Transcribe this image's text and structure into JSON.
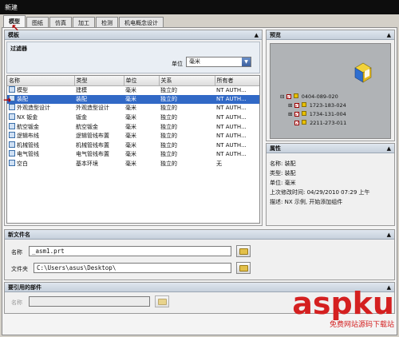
{
  "window": {
    "title": "新建"
  },
  "tabs": [
    "模型",
    "图纸",
    "仿真",
    "加工",
    "检测",
    "机电概念设计"
  ],
  "template_panel": {
    "title": "模板",
    "filter_title": "过滤器",
    "unit_label": "单位",
    "unit_value": "毫米",
    "columns": [
      "名称",
      "类型",
      "单位",
      "关系",
      "所有者"
    ],
    "rows": [
      {
        "name": "模型",
        "type": "建模",
        "unit": "毫米",
        "relation": "独立的",
        "owner": "NT AUTH...",
        "icon": "model-icon",
        "selected": false
      },
      {
        "name": "装配",
        "type": "装配",
        "unit": "毫米",
        "relation": "独立的",
        "owner": "NT AUTH...",
        "icon": "assembly-icon",
        "selected": true
      },
      {
        "name": "外观造型设计",
        "type": "外观造型设计",
        "unit": "毫米",
        "relation": "独立的",
        "owner": "NT AUTH...",
        "icon": "shape-studio-icon",
        "selected": false
      },
      {
        "name": "NX 钣金",
        "type": "钣金",
        "unit": "毫米",
        "relation": "独立的",
        "owner": "NT AUTH...",
        "icon": "sheet-metal-icon",
        "selected": false
      },
      {
        "name": "航空钣金",
        "type": "航空钣金",
        "unit": "毫米",
        "relation": "独立的",
        "owner": "NT AUTH...",
        "icon": "aero-sheet-metal-icon",
        "selected": false
      },
      {
        "name": "逻辑布线",
        "type": "逻辑管线布置",
        "unit": "毫米",
        "relation": "独立的",
        "owner": "NT AUTH...",
        "icon": "logical-routing-icon",
        "selected": false
      },
      {
        "name": "机械管线",
        "type": "机械管线布置",
        "unit": "毫米",
        "relation": "独立的",
        "owner": "NT AUTH...",
        "icon": "mechanical-routing-icon",
        "selected": false
      },
      {
        "name": "电气管线",
        "type": "电气管线布置",
        "unit": "毫米",
        "relation": "独立的",
        "owner": "NT AUTH...",
        "icon": "electrical-routing-icon",
        "selected": false
      },
      {
        "name": "空白",
        "type": "基本环境",
        "unit": "毫米",
        "relation": "独立的",
        "owner": "无",
        "icon": "blank-icon",
        "selected": false
      }
    ]
  },
  "preview": {
    "title": "预览",
    "tree": [
      "0404-089-020",
      "1723-183-024",
      "1734-131-004",
      "2211-273-011"
    ]
  },
  "properties": {
    "title": "属性",
    "rows": [
      "名称: 装配",
      "类型: 装配",
      "单位: 毫米",
      "上次修改时间: 04/29/2010 07:29 上午",
      "描述: NX 示例, 开始添加组件"
    ]
  },
  "new_file": {
    "title": "新文件名",
    "name_label": "名称",
    "name_value": "_asm1.prt",
    "folder_label": "文件夹",
    "folder_value": "C:\\Users\\asus\\Desktop\\"
  },
  "referenced_part": {
    "title": "要引用的部件",
    "name_label": "名称",
    "name_value": ""
  },
  "watermark": {
    "big": "aspku",
    "small": "免费网站源码下载站"
  },
  "colors": {
    "selection": "#3169c6",
    "title_bar": "#0d0d0d",
    "panel_header": "#c6d0dc",
    "watermark": "#d42020"
  }
}
